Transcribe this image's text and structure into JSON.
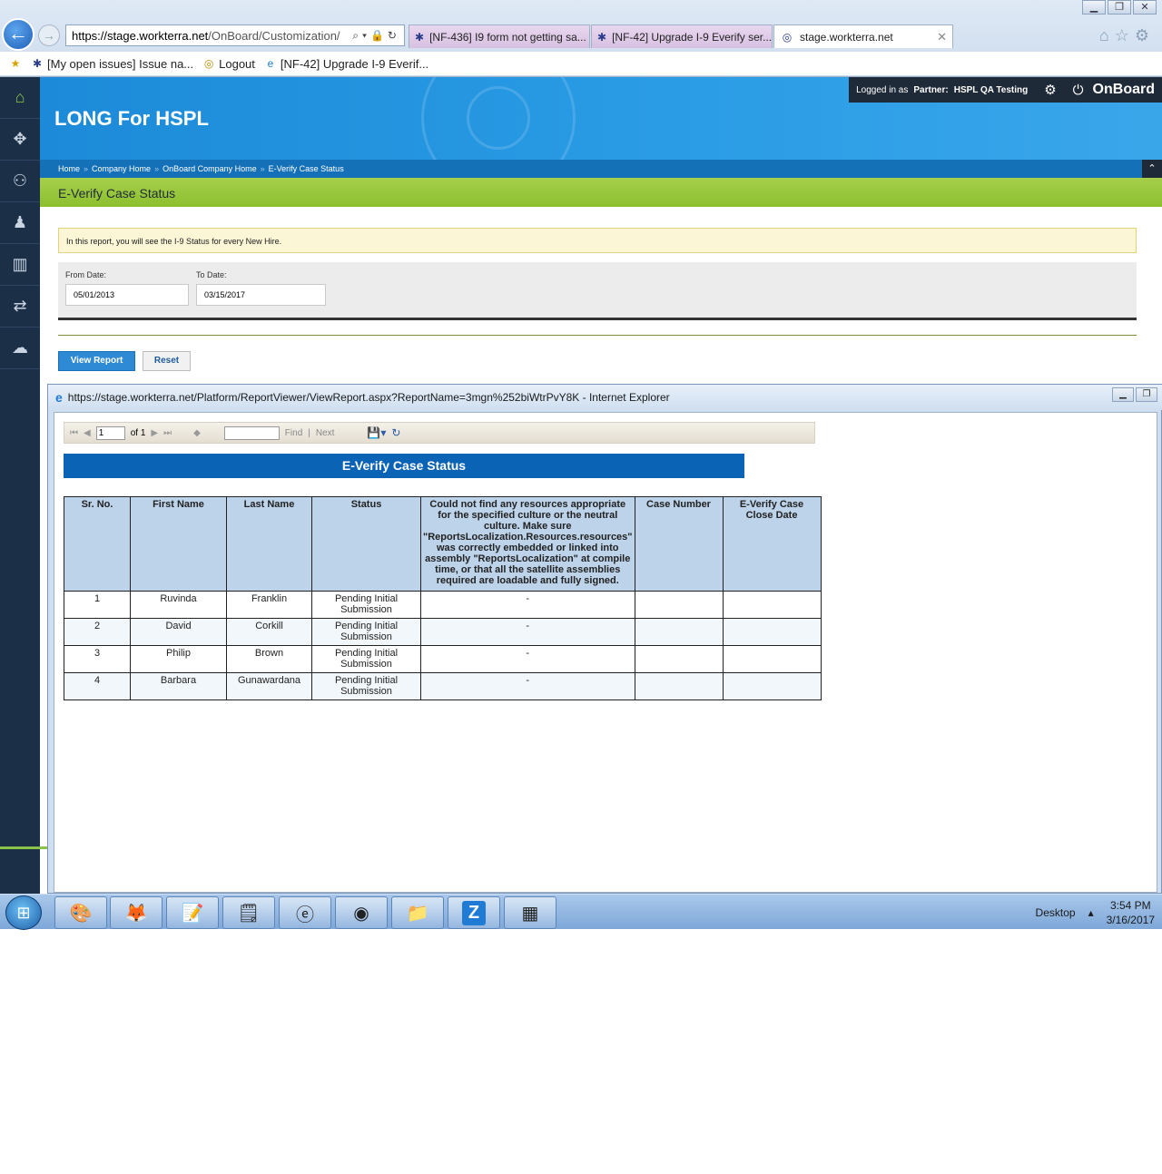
{
  "browser": {
    "address_host": "https://stage.workterra.net",
    "address_rest": "/OnBoard/Customization/",
    "tabs": [
      {
        "label": "[NF-436] I9 form not getting sa..."
      },
      {
        "label": "[NF-42] Upgrade I-9 Everify ser..."
      },
      {
        "label": "stage.workterra.net"
      }
    ],
    "favorites": [
      {
        "label": "[My open issues] Issue na..."
      },
      {
        "label": "Logout"
      },
      {
        "label": "[NF-42] Upgrade I-9 Everif..."
      }
    ]
  },
  "app": {
    "title": "LONG For HSPL",
    "logged_in_prefix": "Logged in as",
    "partner_label": "Partner:",
    "partner_name": "HSPL QA Testing",
    "product": "OnBoard",
    "breadcrumb": [
      "Home",
      "Company Home",
      "OnBoard Company Home",
      "E-Verify Case Status"
    ],
    "page_title": "E-Verify Case Status",
    "sidebar_icons": [
      "home-icon",
      "puzzle-icon",
      "user-settings-icon",
      "person-icon",
      "bar-chart-icon",
      "transfer-icon",
      "chat-icon"
    ]
  },
  "report_form": {
    "info_text": "In this report, you will see the I-9 Status for every New Hire.",
    "from_date_label": "From Date:",
    "from_date_value": "05/01/2013",
    "to_date_label": "To Date:",
    "to_date_value": "03/15/2017",
    "view_report_label": "View Report",
    "reset_label": "Reset"
  },
  "popup": {
    "title": "https://stage.workterra.net/Platform/ReportViewer/ViewReport.aspx?ReportName=3mgn%252biWtrPvY8K - Internet Explorer",
    "toolbar": {
      "page_value": "1",
      "of_label": "of 1",
      "find_label": "Find",
      "separator": "|",
      "next_label": "Next"
    },
    "report_title": "E-Verify Case Status",
    "columns": [
      "Sr. No.",
      "First Name",
      "Last Name",
      "Status",
      "Could not find any resources appropriate for the specified culture or the neutral culture.  Make sure \"ReportsLocalization.Resources.resources\" was correctly embedded or linked into assembly \"ReportsLocalization\" at compile time, or that all the satellite assemblies required are loadable and fully signed.",
      "Case Number",
      "E-Verify Case Close Date"
    ],
    "rows": [
      {
        "sr": "1",
        "first": "Ruvinda",
        "last": "Franklin",
        "status": "Pending Initial Submission",
        "resource": "-",
        "case_number": "",
        "close_date": ""
      },
      {
        "sr": "2",
        "first": "David",
        "last": "Corkill",
        "status": "Pending Initial Submission",
        "resource": "-",
        "case_number": "",
        "close_date": ""
      },
      {
        "sr": "3",
        "first": "Philip",
        "last": "Brown",
        "status": "Pending Initial Submission",
        "resource": "-",
        "case_number": "",
        "close_date": ""
      },
      {
        "sr": "4",
        "first": "Barbara",
        "last": "Gunawardana",
        "status": "Pending Initial Submission",
        "resource": "-",
        "case_number": "",
        "close_date": ""
      }
    ]
  },
  "taskbar": {
    "desktop_label": "Desktop",
    "time": "3:54 PM",
    "date": "3/16/2017",
    "apps": [
      "paint-icon",
      "firefox-icon",
      "notepad-icon",
      "sticky-notes-icon",
      "internet-explorer-icon",
      "chrome-icon",
      "file-explorer-icon",
      "z-app-icon",
      "calculator-icon"
    ]
  }
}
